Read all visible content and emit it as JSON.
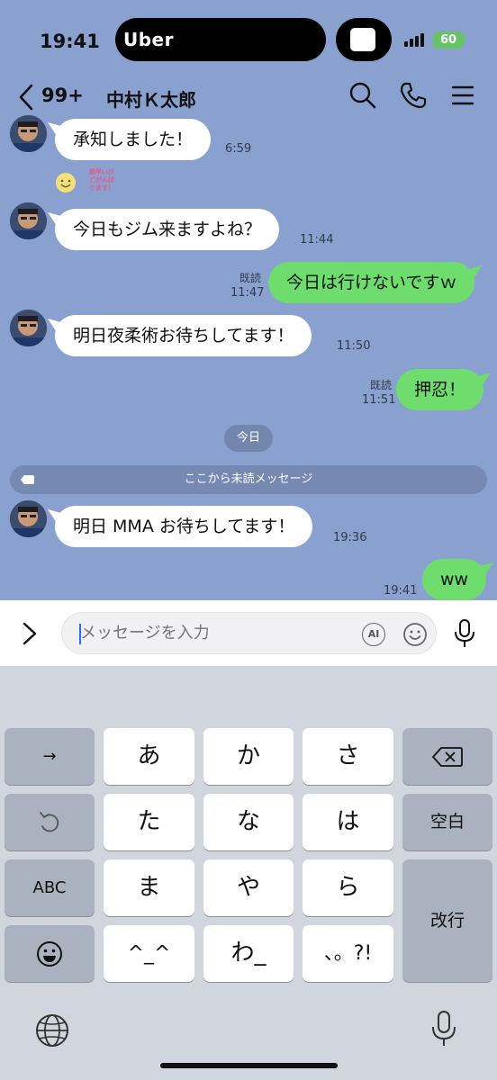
{
  "status_bar": {
    "time": "19:41",
    "live_activity": "Uber",
    "battery": "60"
  },
  "header": {
    "unread_count": "99+",
    "contact_name": "中村Ｋ太郎",
    "icons": [
      "back-chevron-icon",
      "search-icon",
      "phone-icon",
      "menu-icon"
    ]
  },
  "messages": [
    {
      "dir": "in",
      "text": "承知しました！",
      "time": "6:59"
    },
    {
      "dir": "in",
      "type": "sticker",
      "sticker_text": "朝早いけどがんばります！"
    },
    {
      "dir": "in",
      "text": "今日もジム来ますよね？",
      "time": "11:44"
    },
    {
      "dir": "out",
      "text": "今日は行けないですｗ",
      "read": "既読",
      "time": "11:47"
    },
    {
      "dir": "in",
      "text": "明日夜柔術お待ちしてます！",
      "time": "11:50"
    },
    {
      "dir": "out",
      "text": "押忍！",
      "read": "既読",
      "time": "11:51"
    },
    {
      "dir": "in",
      "text": "明日 MMA お待ちしてます！",
      "time": "19:36"
    },
    {
      "dir": "out",
      "text": "ww",
      "time": "19:41"
    }
  ],
  "date_separator": "今日",
  "unread_divider": "ここから未読メッセージ",
  "input": {
    "placeholder": "メッセージを入力",
    "ai_label": "AI"
  },
  "keyboard": {
    "rows": [
      {
        "left": "→",
        "keys": [
          "あ",
          "か",
          "さ"
        ],
        "right": "delete-icon"
      },
      {
        "left": "undo-icon",
        "keys": [
          "た",
          "な",
          "は"
        ],
        "right": "空白"
      },
      {
        "left": "ABC",
        "keys": [
          "ま",
          "や",
          "ら"
        ],
        "right": "改行"
      },
      {
        "left": "emoji-icon",
        "keys": [
          "^_^",
          "わ_",
          "、。?!"
        ]
      }
    ]
  },
  "colors": {
    "chat_background": "#8aa1cf",
    "outgoing_bubble": "#6fdd6e",
    "incoming_bubble": "#ffffff",
    "keyboard_background": "#d1d6de"
  }
}
